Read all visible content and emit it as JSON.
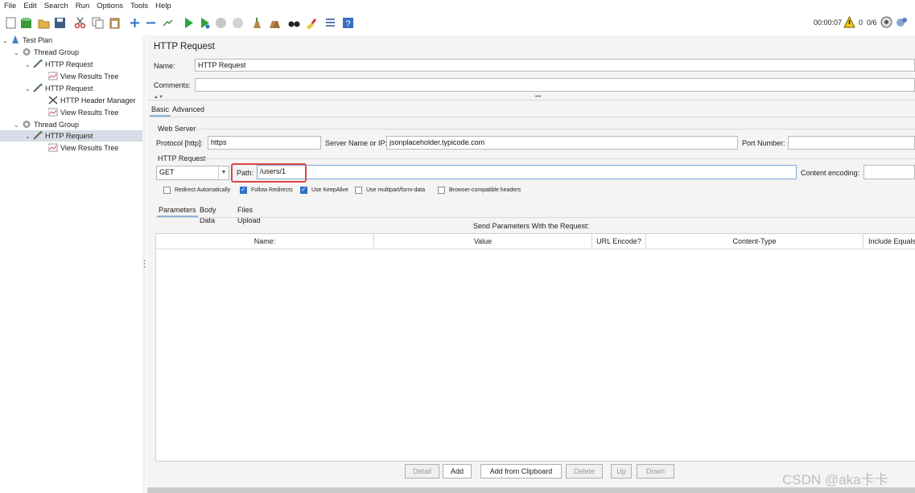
{
  "menu": [
    "File",
    "Edit",
    "Search",
    "Run",
    "Options",
    "Tools",
    "Help"
  ],
  "status": {
    "elapsed": "00:00:07",
    "warnings": "0",
    "threads": "0/6"
  },
  "tree": [
    {
      "label": "Test Plan",
      "depth": 0,
      "icon": "test-plan-icon",
      "expanded": true
    },
    {
      "label": "Thread Group",
      "depth": 1,
      "icon": "gear-icon",
      "expanded": true
    },
    {
      "label": "HTTP Request",
      "depth": 2,
      "icon": "pipette-icon",
      "expanded": true
    },
    {
      "label": "View Results Tree",
      "depth": 3,
      "icon": "chart-icon"
    },
    {
      "label": "HTTP Request",
      "depth": 2,
      "icon": "pipette-icon",
      "expanded": true
    },
    {
      "label": "HTTP Header Manager",
      "depth": 3,
      "icon": "tools-icon"
    },
    {
      "label": "View Results Tree",
      "depth": 3,
      "icon": "chart-icon"
    },
    {
      "label": "Thread Group",
      "depth": 1,
      "icon": "gear-icon",
      "expanded": true
    },
    {
      "label": "HTTP Request",
      "depth": 2,
      "icon": "pipette-icon",
      "expanded": true,
      "selected": true
    },
    {
      "label": "View Results Tree",
      "depth": 3,
      "icon": "chart-icon"
    }
  ],
  "panel": {
    "title": "HTTP Request",
    "name_label": "Name:",
    "name_value": "HTTP Request",
    "comments_label": "Comments:",
    "tabs": [
      "Basic",
      "Advanced"
    ],
    "web_server_label": "Web Server",
    "protocol_label": "Protocol [http]:",
    "protocol_value": "https",
    "server_label": "Server Name or IP:",
    "server_value": "jsonplaceholder.typicode.com",
    "port_label": "Port Number:",
    "http_request_label": "HTTP Request",
    "method": "GET",
    "path_label": "Path:",
    "path_value": "/users/1",
    "encoding_label": "Content encoding:",
    "checkboxes": [
      {
        "label": "Redirect Automatically",
        "checked": false
      },
      {
        "label": "Follow Redirects",
        "checked": true
      },
      {
        "label": "Use KeepAlive",
        "checked": true
      },
      {
        "label": "Use multipart/form-data",
        "checked": false
      },
      {
        "label": "Browser-compatible headers",
        "checked": false
      }
    ],
    "subtabs": [
      "Parameters",
      "Body Data",
      "Files Upload"
    ],
    "send_params_label": "Send Parameters With the Request:",
    "columns": [
      "Name:",
      "Value",
      "URL Encode?",
      "Content-Type",
      "Include Equals?"
    ],
    "buttons": [
      {
        "label": "Detail",
        "enabled": false
      },
      {
        "label": "Add",
        "enabled": true
      },
      {
        "label": "Add from Clipboard",
        "enabled": true
      },
      {
        "label": "Delete",
        "enabled": false
      },
      {
        "label": "Up",
        "enabled": false
      },
      {
        "label": "Down",
        "enabled": false
      }
    ]
  },
  "watermark": "CSDN @aka卡卡",
  "colors": {
    "highlight": "#e04545",
    "selected_row": "#d8dce6",
    "checkbox_on": "#2f6fc6"
  }
}
